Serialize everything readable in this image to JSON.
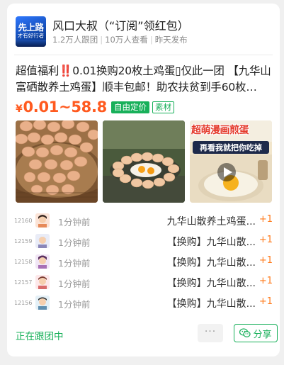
{
  "header": {
    "avatar_text_main": "先上路",
    "avatar_text_sub": "才有好行者",
    "shop_name": "风口大叔（“订阅”领红包）",
    "followers": "1.2万人跟团",
    "views": "10万人查看",
    "published": "昨天发布"
  },
  "product": {
    "title": "超值福利‼️0.01换购20枚土鸡蛋▯仅此一团 【九华山富硒散养土鸡蛋】顺丰包邮！助农扶贫到手60枚…",
    "price_yen": "¥",
    "price_range": "0.01~58.8",
    "tag_custom_price": "自由定价",
    "tag_material": "素材"
  },
  "images": [
    {
      "name": "basket-of-eggs"
    },
    {
      "name": "egg-ring-plate"
    },
    {
      "name": "egg-video-thumbnail",
      "overlay_text_top": "超萌漫画煎蛋",
      "overlay_text_bottom": "再看我就把你吃掉"
    }
  ],
  "orders": [
    {
      "num": "12160",
      "time": "1分钟前",
      "product": "九华山散养土鸡蛋...",
      "qty": "+1"
    },
    {
      "num": "12159",
      "time": "1分钟前",
      "product": "【换购】九华山散...",
      "qty": "+1"
    },
    {
      "num": "12158",
      "time": "1分钟前",
      "product": "【换购】九华山散...",
      "qty": "+1"
    },
    {
      "num": "12157",
      "time": "1分钟前",
      "product": "【换购】九华山散...",
      "qty": "+1"
    },
    {
      "num": "12156",
      "time": "1分钟前",
      "product": "【换购】九华山散...",
      "qty": "+1"
    }
  ],
  "footer": {
    "status": "正在跟团中",
    "more": "···",
    "share": "分享"
  },
  "colors": {
    "accent_green": "#18b05a",
    "price_orange": "#ff5a1f",
    "qty_orange": "#ff7a1a"
  }
}
